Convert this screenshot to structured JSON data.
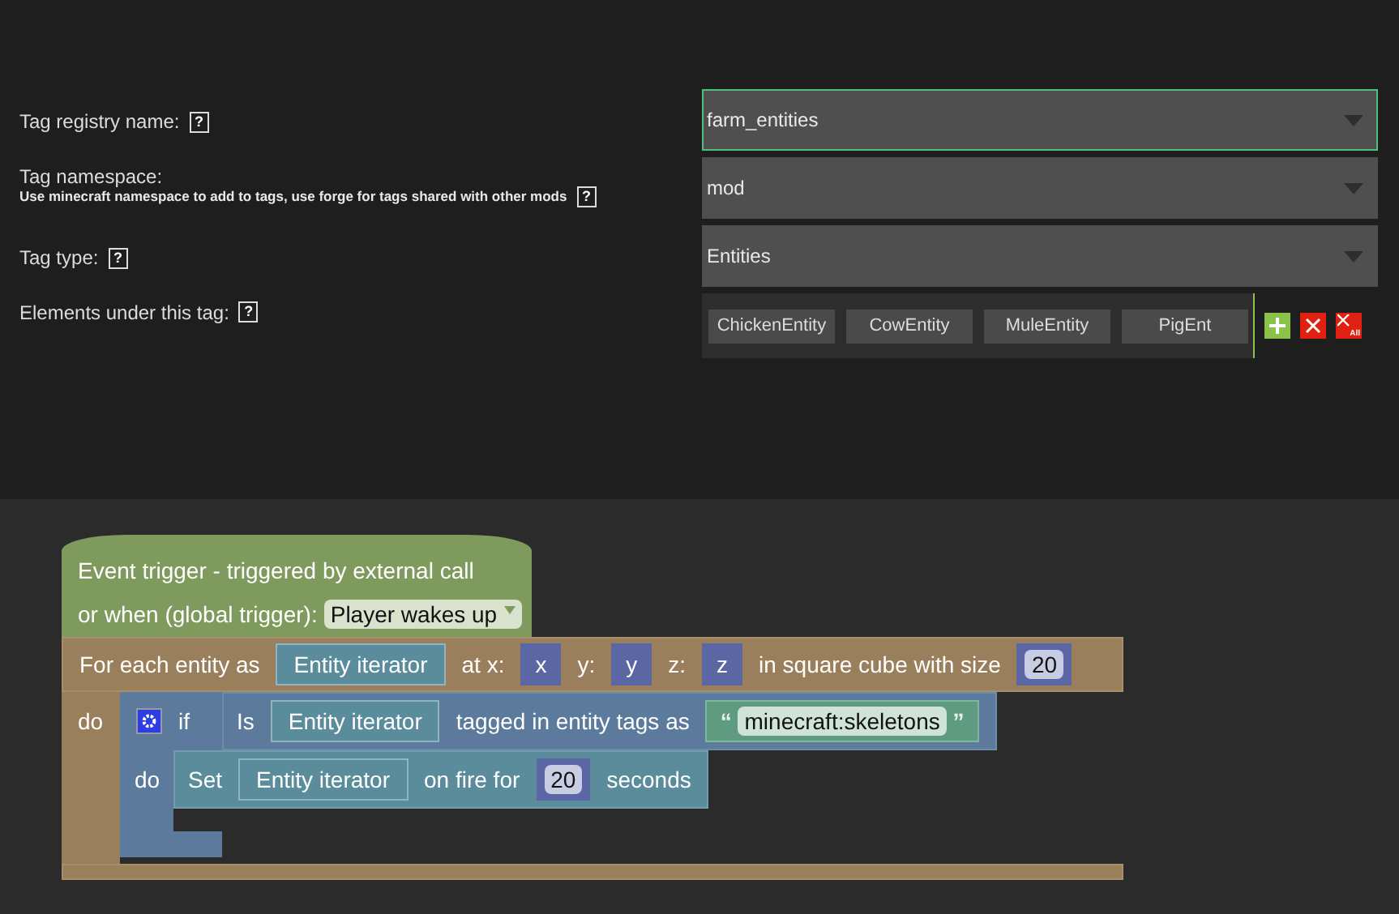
{
  "form": {
    "fields": [
      {
        "label": "Tag registry name:",
        "help": "?",
        "value": "farm_entities",
        "focused": true
      },
      {
        "label": "Tag namespace:",
        "hint": "Use minecraft namespace to add to tags, use forge for tags shared with other mods",
        "help": "?",
        "value": "mod",
        "focused": false
      },
      {
        "label": "Tag type:",
        "help": "?",
        "value": "Entities",
        "focused": false
      }
    ],
    "elements": {
      "label": "Elements under this tag:",
      "help": "?",
      "items": [
        "ChickenEntity",
        "CowEntity",
        "MuleEntity",
        "PigEnt"
      ],
      "remove_all": "All"
    }
  },
  "event_block": {
    "title": "Event trigger - triggered by external call",
    "trigger_label": "or when (global trigger):",
    "trigger": "Player wakes up"
  },
  "for_each_block": {
    "do_label": "do",
    "parts": [
      {
        "kind": "text",
        "text": "For each entity as"
      },
      {
        "kind": "iterator",
        "text": "Entity iterator"
      },
      {
        "kind": "text",
        "text": "at x:"
      },
      {
        "kind": "variable",
        "text": "x"
      },
      {
        "kind": "text",
        "text": "y:"
      },
      {
        "kind": "variable",
        "text": "y"
      },
      {
        "kind": "text",
        "text": "z:"
      },
      {
        "kind": "variable",
        "text": "z"
      },
      {
        "kind": "text",
        "text": "in square cube with size"
      },
      {
        "kind": "number",
        "text": "20"
      }
    ]
  },
  "if_block": {
    "if_label": "if",
    "do_label": "do",
    "condition": [
      {
        "kind": "text",
        "text": "Is"
      },
      {
        "kind": "iterator",
        "text": "Entity iterator"
      },
      {
        "kind": "text",
        "text": "tagged in entity tags as"
      },
      {
        "kind": "string",
        "open": "“",
        "text": "minecraft:skeletons",
        "close": "”"
      }
    ]
  },
  "set_block": {
    "parts": [
      {
        "kind": "text",
        "text": "Set"
      },
      {
        "kind": "iterator",
        "text": "Entity iterator"
      },
      {
        "kind": "text",
        "text": "on fire for"
      },
      {
        "kind": "number",
        "text": "20"
      },
      {
        "kind": "text",
        "text": "seconds"
      }
    ]
  }
}
